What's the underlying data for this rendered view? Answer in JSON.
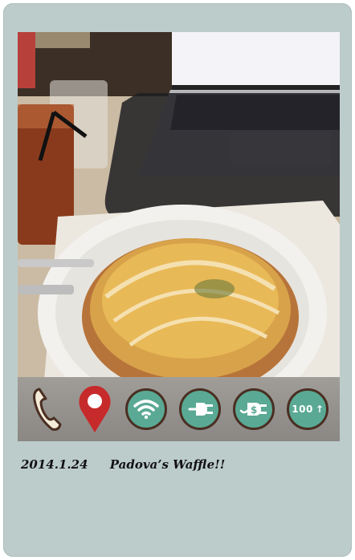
{
  "caption": {
    "date": "2014.1.24",
    "title": "Padova’s Waffle!!"
  },
  "icons": [
    {
      "name": "phone-icon"
    },
    {
      "name": "location-pin-icon"
    },
    {
      "name": "wifi-icon"
    },
    {
      "name": "power-outlet-icon"
    },
    {
      "name": "paid-power-icon"
    },
    {
      "name": "speed-icon",
      "label": "100"
    }
  ],
  "colors": {
    "card": "#bccccb",
    "icon_teal": "#5aa994",
    "icon_border": "#4a2e22",
    "pin_red": "#c62a2a"
  }
}
